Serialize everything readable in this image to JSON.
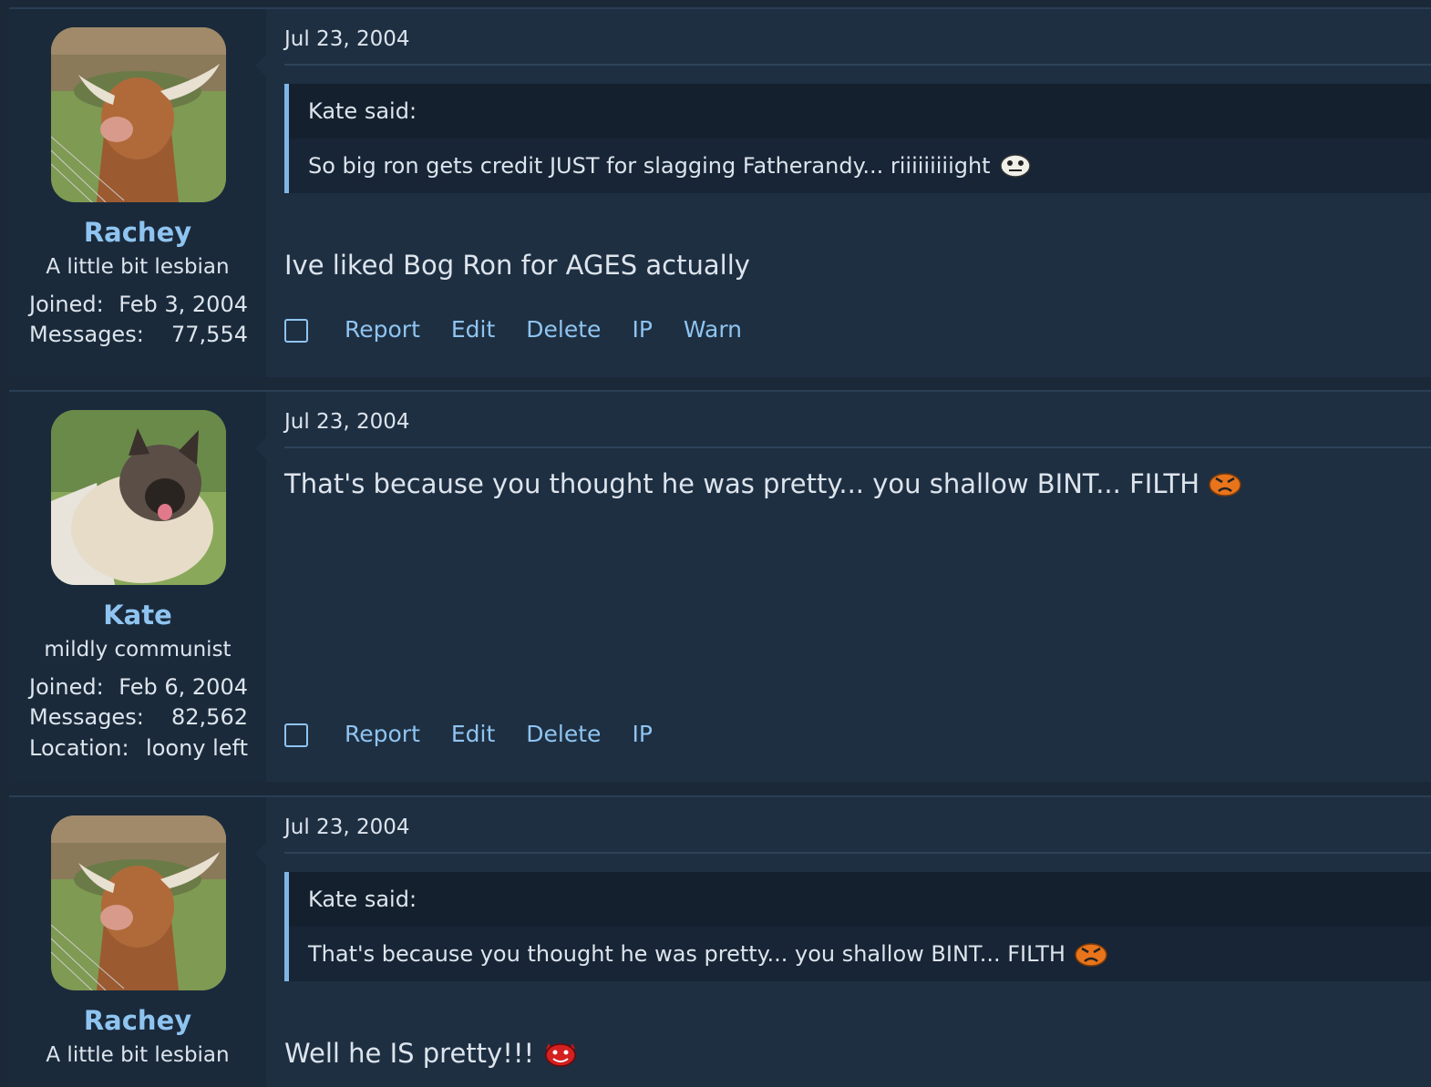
{
  "posts": [
    {
      "user": {
        "name": "Rachey",
        "title": "A little bit lesbian",
        "avatar": "highland-cow-avatar"
      },
      "stats": [
        {
          "label": "Joined:",
          "value": "Feb 3, 2004"
        },
        {
          "label": "Messages:",
          "value": "77,554"
        }
      ],
      "date": "Jul 23, 2004",
      "quote": {
        "author": "Kate said:",
        "text": "So big ron gets credit JUST for slagging Fatherandy... riiiiiiiiight",
        "smiley": "rolleyes-smiley"
      },
      "message": "Ive liked Bog Ron for AGES actually",
      "actions": [
        "Report",
        "Edit",
        "Delete",
        "IP",
        "Warn"
      ]
    },
    {
      "user": {
        "name": "Kate",
        "title": "mildly communist",
        "avatar": "fluffy-dog-avatar"
      },
      "stats": [
        {
          "label": "Joined:",
          "value": "Feb 6, 2004"
        },
        {
          "label": "Messages:",
          "value": "82,562"
        },
        {
          "label": "Location:",
          "value": "loony left"
        }
      ],
      "date": "Jul 23, 2004",
      "message": "That's because you thought he was pretty... you shallow BINT... FILTH",
      "message_smiley": "angry-smiley",
      "actions": [
        "Report",
        "Edit",
        "Delete",
        "IP"
      ]
    },
    {
      "user": {
        "name": "Rachey",
        "title": "A little bit lesbian",
        "avatar": "highland-cow-avatar"
      },
      "date": "Jul 23, 2004",
      "quote": {
        "author": "Kate said:",
        "text": "That's because you thought he was pretty... you shallow BINT... FILTH",
        "smiley": "angry-smiley"
      },
      "message": "Well he IS pretty!!!",
      "message_smiley": "devil-smiley"
    }
  ]
}
